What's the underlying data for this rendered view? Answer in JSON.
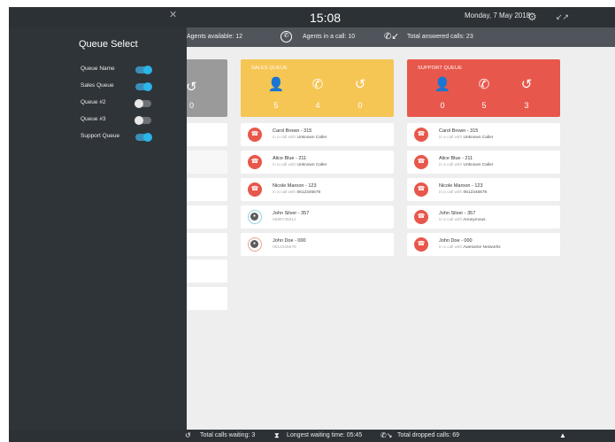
{
  "header": {
    "time": "15:08",
    "date": "Monday, 7 May 2018",
    "icons": [
      "close-icon",
      "gear-icon",
      "shrink-icon"
    ]
  },
  "stats": {
    "agents_available": "Agents available: 12",
    "agents_in_call": "Agents in a call: 10",
    "total_answered": "Total answered calls: 23"
  },
  "footer": {
    "calls_waiting": "Total calls waiting: 3",
    "longest_wait": "Longest waiting time: 05:45",
    "dropped": "Total dropped calls: 69",
    "expand_icon": "chevron-up-icon"
  },
  "drawer": {
    "title": "Queue Select",
    "items": [
      {
        "label": "Queue Name",
        "enabled": true
      },
      {
        "label": "Sales Queue",
        "enabled": true
      },
      {
        "label": "Queue #2",
        "enabled": false
      },
      {
        "label": "Queue #3",
        "enabled": false
      },
      {
        "label": "Support Queue",
        "enabled": true
      }
    ]
  },
  "partial_queue": {
    "waiting_value": "0"
  },
  "sales_queue": {
    "title": "SALES QUEUE",
    "color": "#f6c655",
    "agents": "5",
    "in_call": "4",
    "waiting": "0",
    "calls": [
      {
        "name": "Carol Brown - 315",
        "prefix": "in a call with",
        "with": "Unknown Caller",
        "state": "in-call"
      },
      {
        "name": "Alice Blue - 211",
        "prefix": "in a call with",
        "with": "Unknown Caller",
        "state": "in-call"
      },
      {
        "name": "Nicole  Maroon - 123",
        "prefix": "in a call with",
        "with": "0612345678",
        "state": "in-call"
      },
      {
        "name": "John Silver - 357",
        "prefix": "",
        "with": "0698745612",
        "state": "waiting"
      },
      {
        "name": "John Doe - 000",
        "prefix": "",
        "with": "0612345678",
        "state": "waiting"
      }
    ]
  },
  "support_queue": {
    "title": "SUPPORT QUEUE",
    "color": "#e8574b",
    "agents": "0",
    "in_call": "5",
    "waiting": "3",
    "calls": [
      {
        "name": "Carol Brown - 315",
        "prefix": "in a call with",
        "with": "Unknown Caller"
      },
      {
        "name": "Alice Blue - 211",
        "prefix": "in a call with",
        "with": "Unknown Caller"
      },
      {
        "name": "Nicole Maroon - 123",
        "prefix": "in a call with",
        "with": "0612345678"
      },
      {
        "name": "John Silver - 357",
        "prefix": "in a call with",
        "with": "Anonymous"
      },
      {
        "name": "John Doe - 000",
        "prefix": "in a call with",
        "with": "Awesome Networks"
      }
    ]
  }
}
